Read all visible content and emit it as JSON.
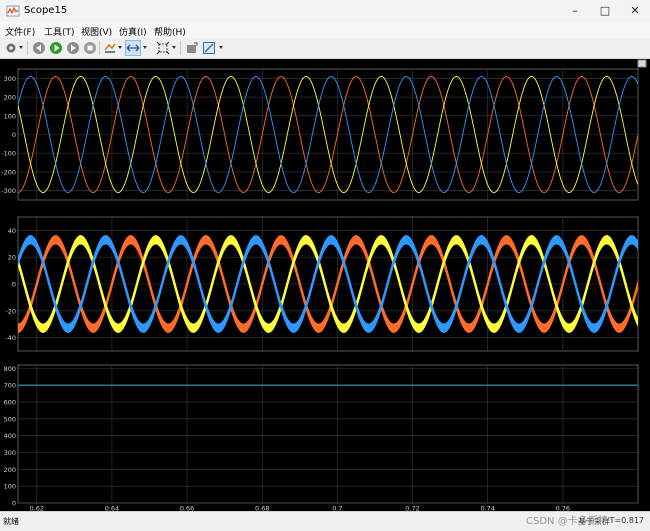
{
  "window": {
    "title": "Scope15"
  },
  "menu": [
    "文件(F)",
    "工具(T)",
    "视图(V)",
    "仿真(I)",
    "帮助(H)"
  ],
  "toolbar": {
    "icons": [
      "gear-icon",
      "step-back-icon",
      "run-icon",
      "step-forward-icon",
      "stop-icon",
      "highlight-icon",
      "zoom-icon",
      "autoscale-icon",
      "cursor-icon",
      "style-icon"
    ]
  },
  "colors": {
    "phase_a": "#ff6b2a",
    "phase_b": "#ffff3a",
    "phase_c": "#2f98ff",
    "dc": "#3aa1b8",
    "grid": "#3c3c3c",
    "axis_text": "#d0d0d0"
  },
  "chart_data": [
    {
      "type": "line",
      "title": "",
      "xlim": [
        0.615,
        0.78
      ],
      "ylim": [
        -350,
        350
      ],
      "yticks": [
        300,
        200,
        100,
        0,
        -100,
        -200,
        -300
      ],
      "waveform": {
        "frequency_hz": 50,
        "amplitude": 310,
        "phase_deg": [
          0,
          -120,
          120
        ],
        "band": 0
      },
      "series": [
        {},
        {},
        {}
      ],
      "grid": true
    },
    {
      "type": "line",
      "title": "",
      "xlim": [
        0.615,
        0.78
      ],
      "ylim": [
        -50,
        50
      ],
      "yticks": [
        40,
        20,
        0,
        -20,
        -40
      ],
      "waveform": {
        "frequency_hz": 50,
        "amplitude": 33,
        "phase_deg": [
          0,
          -120,
          120
        ],
        "band": 3.5
      },
      "series": [
        {},
        {},
        {}
      ],
      "grid": true
    },
    {
      "type": "line",
      "title": "",
      "xlim": [
        0.615,
        0.78
      ],
      "ylim": [
        0,
        820
      ],
      "yticks": [
        800,
        700,
        600,
        500,
        400,
        300,
        200,
        100,
        0
      ],
      "constant": 700,
      "grid": true
    }
  ],
  "xaxis": {
    "ticks": [
      0.62,
      0.64,
      0.66,
      0.68,
      0.7,
      0.72,
      0.74,
      0.76
    ],
    "labels": [
      "0.62",
      "0.64",
      "0.66",
      "0.68",
      "0.7",
      "0.72",
      "0.74",
      "0.76"
    ]
  },
  "status": {
    "left": "就绪",
    "right": "基于采样",
    "time": "T=0.817"
  },
  "watermark": "CSDN @卡多斯特"
}
